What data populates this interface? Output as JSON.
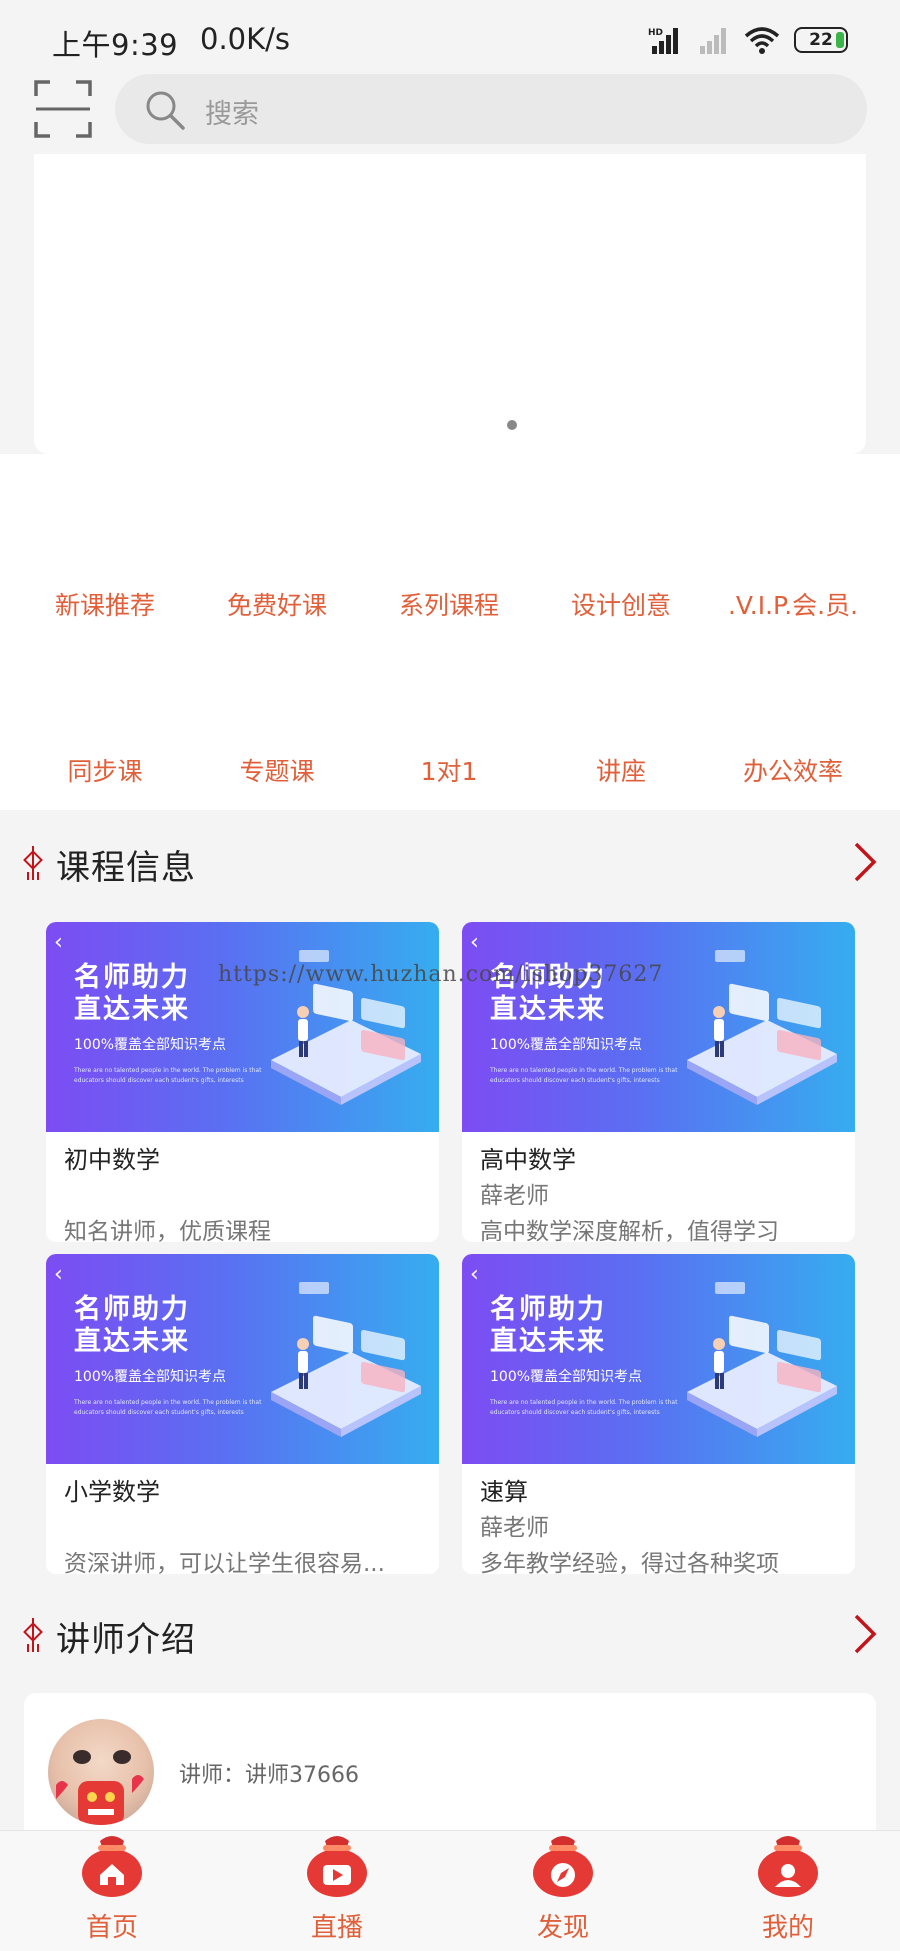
{
  "status": {
    "time": "上午9:39",
    "speed": "0.0K/s",
    "battery": "22"
  },
  "search": {
    "placeholder": "搜索"
  },
  "categories": [
    "新课推荐",
    "免费好课",
    "系列课程",
    "设计创意",
    ".V.I.P.会.员.",
    "同步课",
    "专题课",
    "1对1",
    "讲座",
    "办公效率"
  ],
  "course_section": {
    "title": "课程信息"
  },
  "course_banner": {
    "headline_1": "名师助力",
    "headline_2": "直达未来",
    "subline": "100%覆盖全部知识考点",
    "fine_print": "There are no talented people in the world. The problem is that educators should discover each student's gifts, interests"
  },
  "courses": [
    {
      "title": "初中数学",
      "teacher": "",
      "desc": "知名讲师，优质课程"
    },
    {
      "title": "高中数学",
      "teacher": "薛老师",
      "desc": "高中数学深度解析，值得学习"
    },
    {
      "title": "小学数学",
      "teacher": "",
      "desc": "资深讲师，可以让学生很容易..."
    },
    {
      "title": "速算",
      "teacher": "薛老师",
      "desc": "多年教学经验，得过各种奖项"
    }
  ],
  "watermark": "https://www.huzhan.com/ishop37627",
  "teacher_section": {
    "title": "讲师介绍"
  },
  "teacher": {
    "label": "讲师：讲师37666"
  },
  "tabbar": [
    {
      "label": "首页",
      "icon": "home-icon"
    },
    {
      "label": "直播",
      "icon": "live-icon"
    },
    {
      "label": "发现",
      "icon": "compass-icon"
    },
    {
      "label": "我的",
      "icon": "user-icon"
    }
  ],
  "colors": {
    "accent": "#e0603b",
    "chevron": "#c2141a",
    "banner_from": "#7d4cf3",
    "banner_to": "#36adf0"
  }
}
